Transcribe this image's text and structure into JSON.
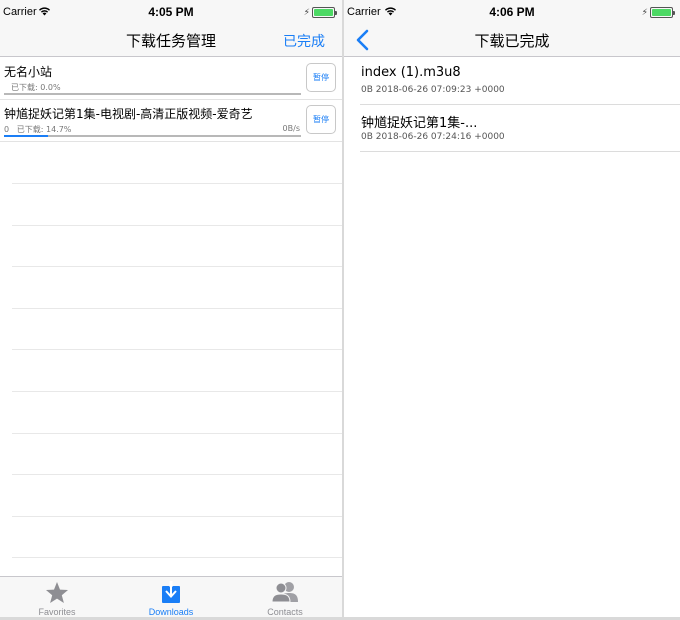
{
  "left": {
    "status": {
      "carrier": "Carrier",
      "time": "4:05 PM"
    },
    "nav": {
      "title": "下载任务管理",
      "right_button": "已完成"
    },
    "tasks": [
      {
        "title": "无名小站",
        "downloaded_label": "已下载:",
        "downloaded": "0.0%",
        "progress": 0.0,
        "pause_label": "暂停"
      },
      {
        "title": "钟馗捉妖记第1集-电视剧-高清正版视频-爱奇艺",
        "size": "0",
        "downloaded_label": "已下载:",
        "downloaded": "14.7%",
        "speed": "0B/s",
        "progress": 0.147,
        "pause_label": "暂停"
      }
    ],
    "tabs": [
      {
        "label": "Favorites",
        "icon": "star-icon",
        "active": false
      },
      {
        "label": "Downloads",
        "icon": "download-icon",
        "active": true
      },
      {
        "label": "Contacts",
        "icon": "contacts-icon",
        "active": false
      }
    ]
  },
  "right": {
    "status": {
      "carrier": "Carrier",
      "time": "4:06 PM"
    },
    "nav": {
      "title": "下载已完成",
      "back_icon": "chevron-left-icon"
    },
    "items": [
      {
        "title": "index (1).m3u8",
        "subtitle": "0B 2018-06-26 07:09:23 +0000"
      },
      {
        "title": "钟馗捉妖记第1集-...",
        "subtitle": "0B 2018-06-26 07:24:16 +0000"
      }
    ]
  },
  "colors": {
    "accent": "#1a7ef6",
    "battery": "#4cd964",
    "tab_inactive": "#8e8e93"
  }
}
